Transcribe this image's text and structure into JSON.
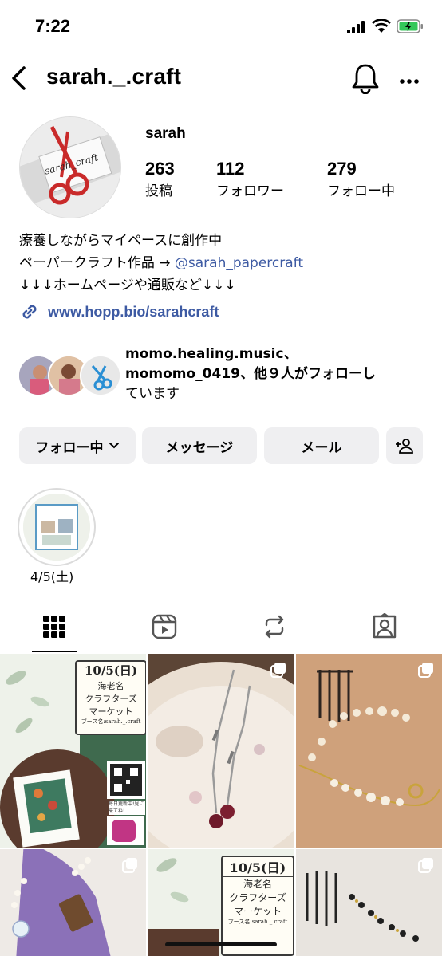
{
  "status_bar": {
    "time": "7:22"
  },
  "header": {
    "username": "sarah._.craft"
  },
  "avatar": {
    "logo_text": "sarah_craft"
  },
  "profile": {
    "display_name": "sarah",
    "stats": [
      {
        "value": "263",
        "label": "投稿"
      },
      {
        "value": "112",
        "label": "フォロワー"
      },
      {
        "value": "279",
        "label": "フォロー中"
      }
    ],
    "bio_line1": "療養しながらマイペースに創作中",
    "bio_line2_prefix": "ペーパークラフト作品 → ",
    "bio_line2_mention": "@sarah_papercraft",
    "bio_line3": "↓↓↓ホームページや通販など↓↓↓",
    "website": "www.hopp.bio/sarahcraft"
  },
  "followed_by": {
    "line1": "momo.healing.music、",
    "line2": "momomo_0419、他９人がフォローし",
    "line3": "ています"
  },
  "actions": {
    "following": "フォロー中",
    "message": "メッセージ",
    "mail": "メール"
  },
  "highlight": {
    "label": "4/5(土)"
  },
  "posts": {
    "event_date": "10/5(日)",
    "event_place": "海老名",
    "event_name1": "クラフターズ",
    "event_name2": "マーケット",
    "booth": "ブース名:sarah._.craft",
    "qr_caption": "毎日更新中!見に来てね!"
  },
  "colors": {
    "accent_link": "#3d5aa3",
    "button_bg": "#efeff1",
    "battery": "#34c759"
  }
}
